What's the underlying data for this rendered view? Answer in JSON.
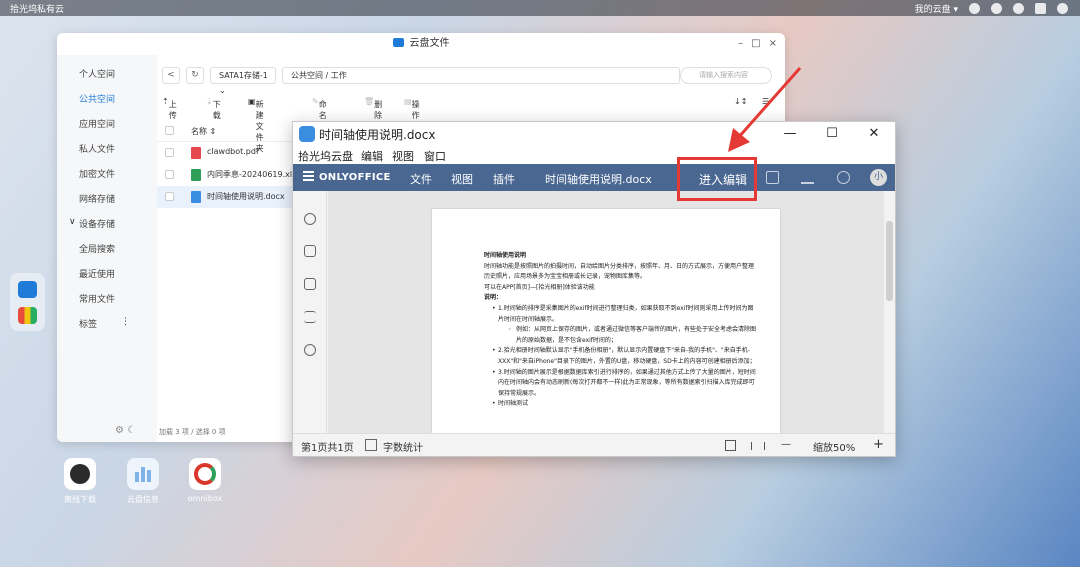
{
  "topbar": {
    "brand": "拾光坞私有云",
    "user_label": "我的云盘",
    "user_caret": "▾"
  },
  "desktop": {
    "icons": [
      {
        "label": "离线下载",
        "color": "#2b2b2b"
      },
      {
        "label": "云盘信息",
        "color": "#7fb3e8"
      },
      {
        "label": "omnibox",
        "color": "#d9372a"
      }
    ]
  },
  "file_manager": {
    "title": "云盘文件",
    "window_controls": [
      "–",
      "□",
      "×"
    ],
    "sidebar": [
      "个人空间",
      "公共空间",
      "应用空间",
      "私人文件",
      "加密文件",
      "网络存储",
      "设备存储",
      "全局搜索",
      "最近使用",
      "常用文件",
      "标签"
    ],
    "sidebar_active": "公共空间",
    "sidebar_caret": "∨",
    "sidebar_more": "⋮",
    "nav_back": "<",
    "nav_refresh": "↻",
    "storage_select": "SATA1存储-1",
    "storage_caret": "⌄",
    "path": "公共空间 / 工作",
    "search_placeholder": "请输入搜索内容",
    "toolbar": {
      "upload": "上传",
      "download": "下载",
      "new_folder": "新建文件夹",
      "rename": "命名名",
      "delete": "删除",
      "more": "操作"
    },
    "sort_label": "↓↕",
    "view_icon": "☰",
    "column_name": "名称",
    "column_sort": "⇕",
    "files": [
      {
        "name": "clawdbot.pdf",
        "color": "#e5484d"
      },
      {
        "name": "内同季息-20240619.xlsx",
        "color": "#2e9e58"
      },
      {
        "name": "时间轴使用说明.docx",
        "color": "#3a8de0"
      }
    ],
    "status": "加载 3 项 / 选择 0 项",
    "bottom_icons": "⚙ ☾"
  },
  "editor": {
    "title": "时间轴使用说明.docx",
    "window_controls": [
      "—",
      "☐",
      "✕"
    ],
    "menu": [
      "拾光坞云盘",
      "编辑",
      "视图",
      "窗口"
    ],
    "brand": "ONLYOFFICE",
    "tabs": [
      "文件",
      "视图",
      "插件"
    ],
    "doc_name": "时间轴使用说明.docx",
    "enter_edit": "进入编辑",
    "avatar": "小",
    "page_info": "第1页共1页",
    "word_count": "字数统计",
    "zoom": "缩放50%",
    "zoom_minus": "—",
    "zoom_plus": "+",
    "document": {
      "heading": "时间轴使用说明",
      "p1": "时间轴功能是按照图片的拍摄时间，自动给图片分类排序，按照年、月、日的方式展示，方便用户整理历史照片，应用场景多为宝宝相册或长记录，宠物图库集等。",
      "p2": "可以在APP[首页]—[拾光相册]体验该功能",
      "label": "说明：",
      "b1": "1.时间轴的排序是采集图片的exif时间进行整理归类，如果获取不到exif时间则采用上传时间为图片时间在时间轴展示。",
      "b1a": "例如：从网页上保存的图片，或者通过微信等客户端传的图片，有些处于安全考虑会清除图片的原始数据，是不包含exif时间的；",
      "b2": "2.拾光相册时间轴默认显示\"手机备份相册\"，默认显示内置硬盘下\"来自-我的手机\"、\"来自手机-XXX\"和\"来自iPhone\"目录下的图片，外置的U盘，移动硬盘，SD卡上的内容可创建相册后添加；",
      "b3": "3.时间轴的图片展示是根据数据库索引进行排序的，如果通过其他方式上传了大量的图片，短时间内在时间轴内会有动态刷新(每次打开都不一样)此为正常现象，等所有数据索引扫描入库完成即可保持常规展示。",
      "b4": "时间轴测试"
    }
  },
  "annotation": {
    "color": "#e53935"
  }
}
